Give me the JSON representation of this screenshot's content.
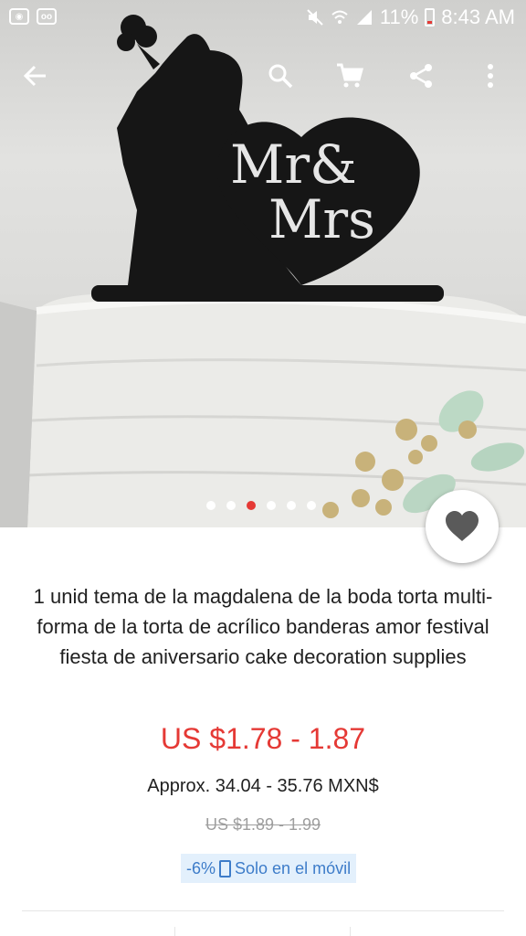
{
  "status_bar": {
    "battery": "11%",
    "time": "8:43 AM"
  },
  "hero": {
    "topper_text_line1": "Mr&",
    "topper_text_line2": "Mrs",
    "image_count": 6,
    "active_image_index": 2
  },
  "toolbar": {
    "back_icon": "arrow-left-icon",
    "search_icon": "search-icon",
    "cart_icon": "cart-icon",
    "share_icon": "share-icon",
    "more_icon": "more-vertical-icon"
  },
  "product": {
    "title": "1 unid tema de la magdalena de la boda torta multi-forma de la torta de acrílico banderas amor festival fiesta de aniversario cake decoration supplies",
    "price": "US $1.78 - 1.87",
    "approx_price": "Approx. 34.04 - 35.76 MXN$",
    "original_price": "US $1.89 - 1.99",
    "discount": "-6%",
    "mobile_only_label": "Solo en el móvil"
  },
  "colors": {
    "accent_red": "#e53935",
    "badge_blue": "#3d7cc9",
    "badge_bg": "#e3f0fc"
  }
}
